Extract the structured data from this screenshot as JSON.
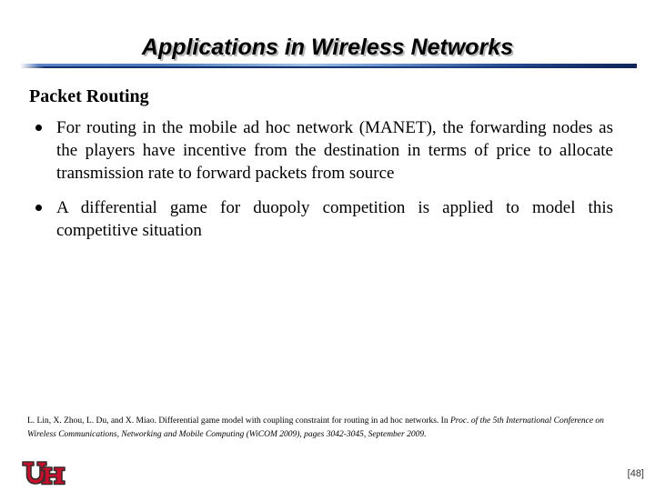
{
  "slide": {
    "title": "Applications in Wireless Networks",
    "section_heading": "Packet Routing",
    "bullets": [
      "For routing in the mobile ad hoc network (MANET), the forwarding nodes as the players have incentive from the destination in terms of price to allocate transmission rate to forward packets from source",
      "A differential game for duopoly competition is applied to model this competitive situation"
    ],
    "citation": {
      "part1": "L. Lin, X. Zhou, L. Du, and X. Miao. Differential game model with coupling constraint for routing in ad hoc networks. In ",
      "italic1": "Proc. of the 5th International Conference on Wireless Communications, Networking and Mobile Computing (WiCOM 2009)",
      "part2": ", pages 3042-3045, September 2009."
    },
    "footer": {
      "page_number": "[48]",
      "logo_alt": "University of Houston UH logo",
      "logo_color": "#c8102e",
      "logo_outline": "#3a2a2a"
    },
    "colors": {
      "title_text": "#000000",
      "title_shadow": "#b9b9b9",
      "divider_light": "#9fc0e6",
      "divider_dark": "#16306e",
      "background": "#ffffff"
    }
  }
}
